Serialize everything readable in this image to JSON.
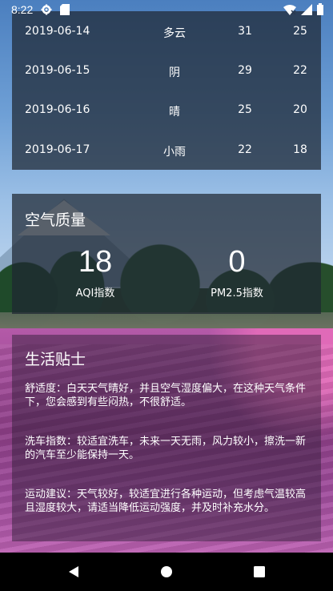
{
  "status_bar": {
    "time": "8:22"
  },
  "forecast": {
    "rows": [
      {
        "date": "2019-06-14",
        "weather": "多云",
        "high": "31",
        "low": "25"
      },
      {
        "date": "2019-06-15",
        "weather": "阴",
        "high": "29",
        "low": "22"
      },
      {
        "date": "2019-06-16",
        "weather": "晴",
        "high": "25",
        "low": "20"
      },
      {
        "date": "2019-06-17",
        "weather": "小雨",
        "high": "22",
        "low": "18"
      }
    ]
  },
  "air_quality": {
    "title": "空气质量",
    "aqi_value": "18",
    "aqi_label": "AQI指数",
    "pm25_value": "0",
    "pm25_label": "PM2.5指数"
  },
  "life_tips": {
    "title": "生活贴士",
    "comfort": "舒适度：白天天气晴好，并且空气湿度偏大，在这种天气条件下，您会感到有些闷热，不很舒适。",
    "car_wash": "洗车指数：较适宜洗车，未来一天无雨，风力较小，擦洗一新的汽车至少能保持一天。",
    "sport": "运动建议：天气较好，较适宜进行各种运动，但考虑气温较高且湿度较大，请适当降低运动强度，并及时补充水分。"
  },
  "icons": {
    "settings": "gear-icon",
    "sd_card": "sd-card-icon",
    "wifi": "wifi-icon",
    "signal": "signal-icon",
    "battery": "battery-icon",
    "back": "back-icon",
    "home": "home-icon",
    "recents": "recents-icon"
  }
}
